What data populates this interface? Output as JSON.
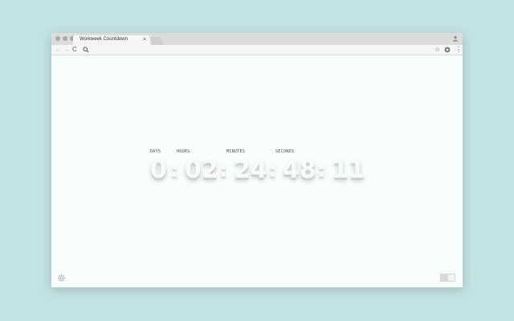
{
  "browser": {
    "tab_title": "Workweek Countdown",
    "tab_close": "×",
    "nav": {
      "back_glyph": "←",
      "forward_glyph": "→",
      "reload_glyph": "C"
    },
    "toolbar": {
      "bookmark_glyph": "☆",
      "menu_glyph": "⋮"
    }
  },
  "countdown": {
    "labels": {
      "days": "DAYS",
      "hours": "HOURS",
      "minutes": "MINUTES",
      "seconds": "SECONDS"
    },
    "values": {
      "days": "0",
      "hours": "02",
      "minutes": "24",
      "seconds": "48",
      "hundredths": "11"
    },
    "separator": ":"
  },
  "colors": {
    "background": "#c3e2e3",
    "page": "#f8fdfd"
  },
  "icons": {
    "settings": "gear-icon",
    "toggle": "toggle-switch"
  }
}
